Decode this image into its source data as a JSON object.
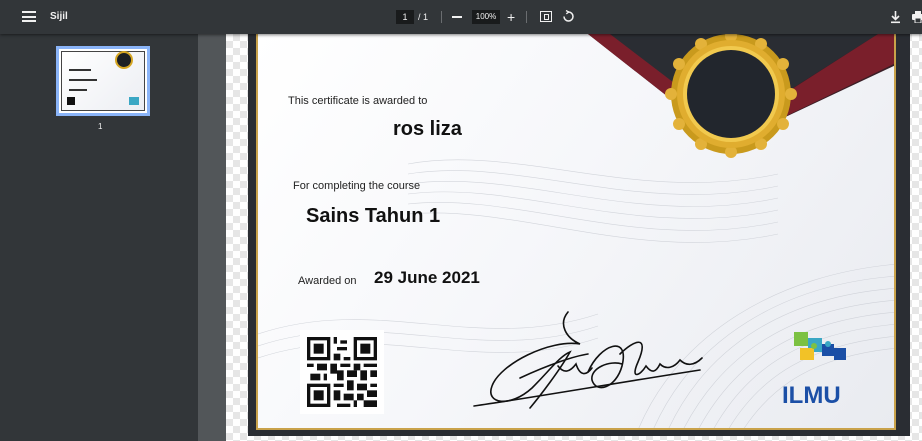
{
  "toolbar": {
    "title": "Sijil",
    "current_page": "1",
    "page_total": "/ 1",
    "zoom": "100%"
  },
  "sidebar": {
    "thumbnails": [
      {
        "page_number": "1"
      }
    ]
  },
  "certificate": {
    "awarded_to_label": "This certificate is awarded to",
    "recipient_name": "ros liza",
    "completing_label": "For completing the course",
    "course_name": "Sains Tahun 1",
    "awarded_on_label": "Awarded on",
    "award_date": "29 June 2021",
    "logo_text": "ILMU"
  },
  "colors": {
    "toolbar_bg": "#323639",
    "viewer_bg": "#525659",
    "thumb_highlight": "#8ab4f8",
    "gold": "#d6a623",
    "logo_blue": "#1b4fa6",
    "logo_teal": "#3aa7c4",
    "logo_green": "#7cc142"
  },
  "icons": {
    "menu": "hamburger-menu-icon",
    "zoom_out": "minus-icon",
    "zoom_in": "plus-icon",
    "fit": "fit-page-icon",
    "rotate": "rotate-icon",
    "download": "download-icon",
    "print": "print-icon"
  }
}
